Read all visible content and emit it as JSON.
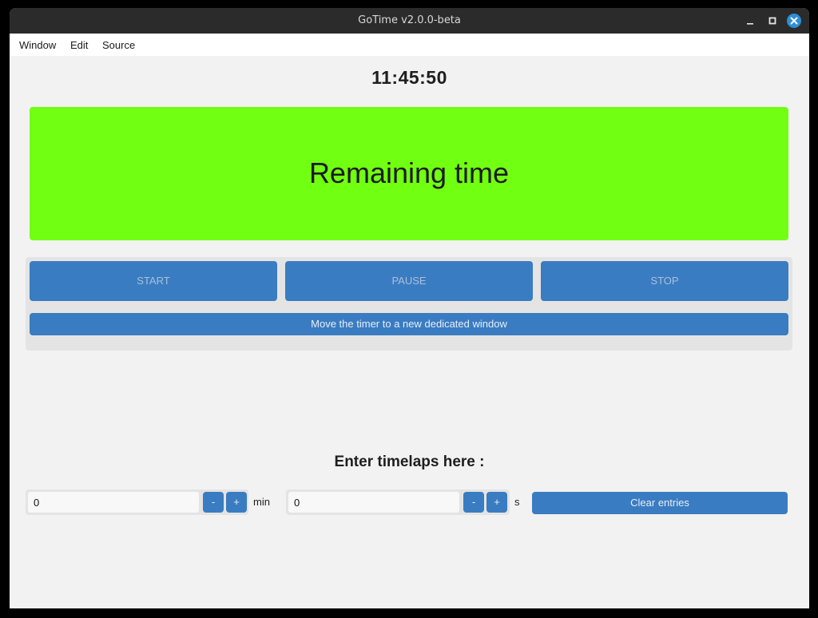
{
  "window": {
    "title": "GoTime v2.0.0-beta"
  },
  "menu": {
    "items": [
      "Window",
      "Edit",
      "Source"
    ]
  },
  "clock": {
    "time": "11:45:50"
  },
  "remaining": {
    "label": "Remaining time",
    "color": "#71ff12"
  },
  "controls": {
    "start_label": "START",
    "pause_label": "PAUSE",
    "stop_label": "STOP",
    "move_label": "Move the timer to a new dedicated window"
  },
  "timelaps": {
    "title": "Enter timelaps here :",
    "minutes": {
      "value": "0",
      "minus_label": "-",
      "plus_label": "+",
      "unit": "min"
    },
    "seconds": {
      "value": "0",
      "minus_label": "-",
      "plus_label": "+",
      "unit": "s"
    },
    "clear_label": "Clear entries"
  },
  "colors": {
    "accent": "#3a7cc1",
    "background": "#f2f2f2",
    "titlebar": "#2b2b2b"
  }
}
